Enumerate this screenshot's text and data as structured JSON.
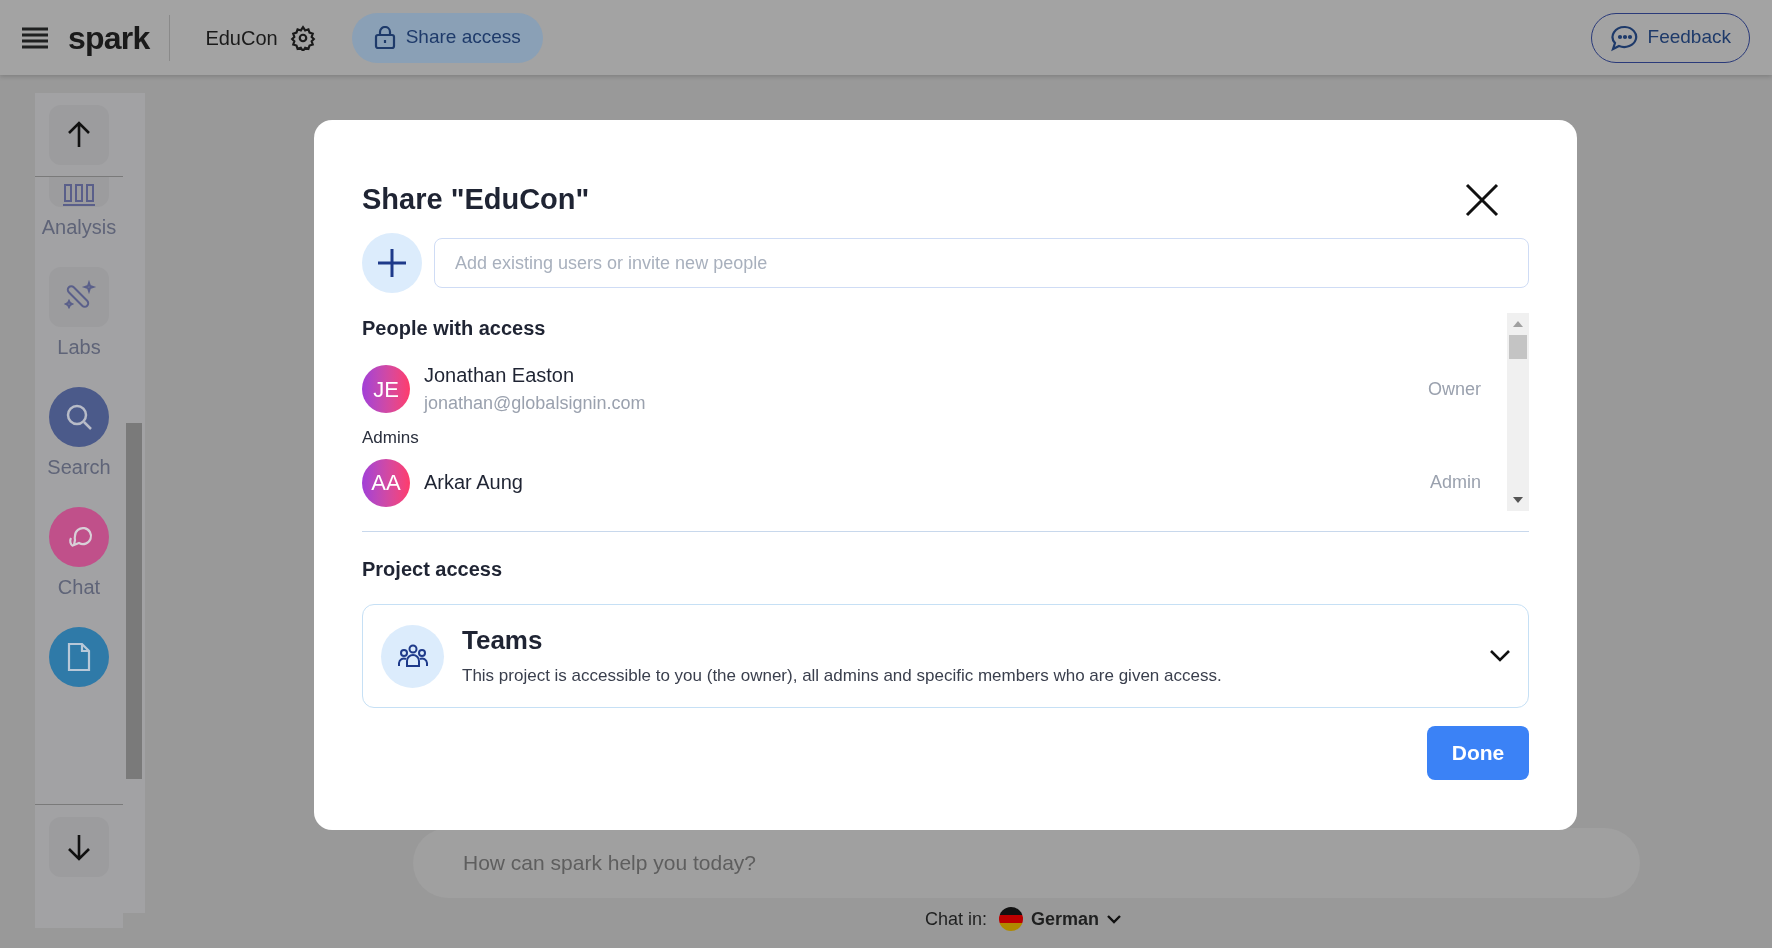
{
  "header": {
    "logo": "spark",
    "project": "EduCon",
    "share_button": "Share access",
    "feedback_button": "Feedback"
  },
  "sidebar": {
    "items": [
      {
        "kind": "tile",
        "label": "Analysis"
      },
      {
        "kind": "tile",
        "label": "Labs"
      },
      {
        "kind": "circle",
        "label": "Search",
        "color": "#4b5a8a"
      },
      {
        "kind": "circle",
        "label": "Chat",
        "color": "#c0508a"
      },
      {
        "kind": "circle",
        "color": "#2f7aa8"
      }
    ]
  },
  "chat": {
    "placeholder": "How can spark help you today?",
    "language_label": "Chat in:",
    "language": "German"
  },
  "dialog": {
    "title": "Share \"EduCon\"",
    "invite": {
      "placeholder": "Add existing users or invite new people"
    },
    "people_heading": "People with access",
    "people": [
      {
        "kind": "person",
        "initials": "JE",
        "name": "Jonathan Easton",
        "email": "jonathan@globalsignin.com",
        "role": "Owner"
      },
      {
        "kind": "group",
        "label": "Admins"
      },
      {
        "kind": "person",
        "initials": "AA",
        "name": "Arkar Aung",
        "role": "Admin"
      }
    ],
    "project_heading": "Project access",
    "access": {
      "title": "Teams",
      "description": "This project is accessible to you (the owner), all admins and specific members who are given access."
    },
    "done_button": "Done"
  }
}
